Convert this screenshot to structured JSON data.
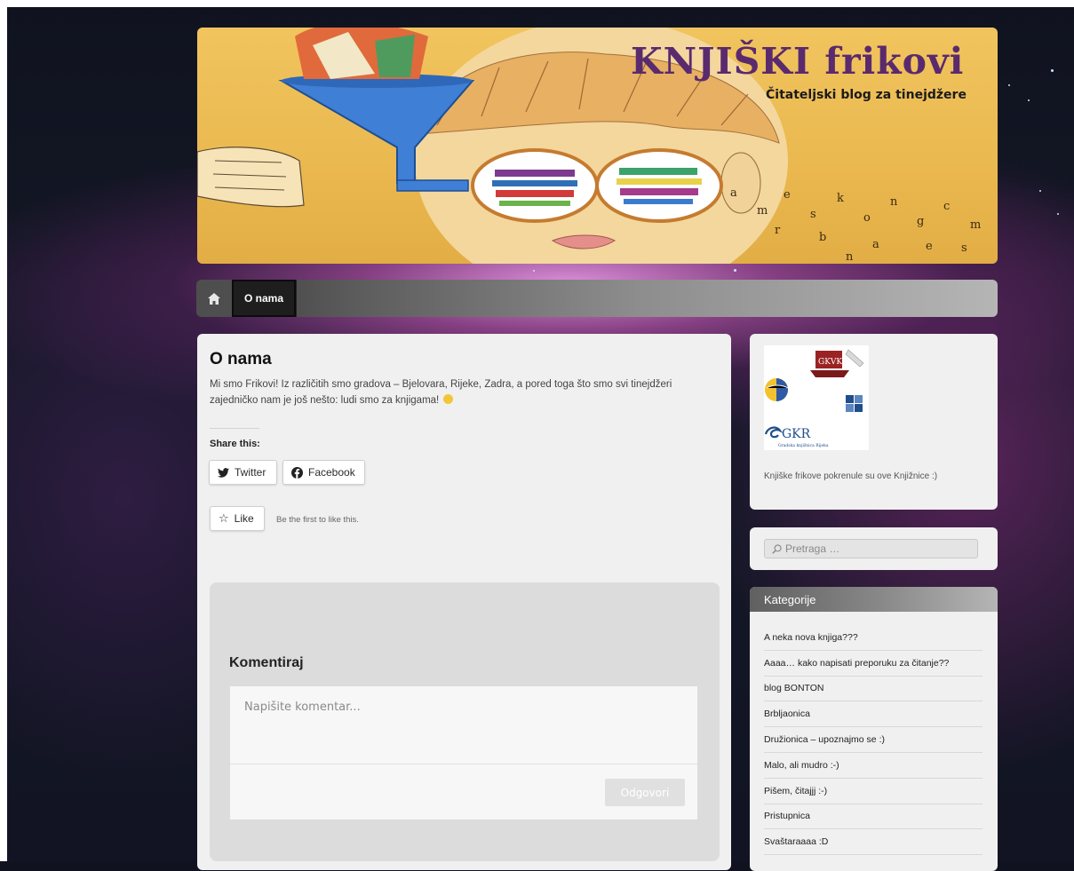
{
  "header": {
    "title": "KNJIŠKI frikovi",
    "tagline": "Čitateljski blog za tinejdžere"
  },
  "nav": {
    "home_icon": "home-icon",
    "items": [
      {
        "label": "O nama",
        "active": true
      }
    ]
  },
  "post": {
    "title": "O nama",
    "text": "Mi smo Frikovi! Iz različitih smo gradova – Bjelovara, Rijeke, Zadra, a pored toga što smo svi tinejdžeri zajedničko nam je još nešto: ludi smo za knjigama!",
    "share_label": "Share this:",
    "share_buttons": [
      {
        "label": "Twitter",
        "icon": "twitter-icon"
      },
      {
        "label": "Facebook",
        "icon": "facebook-icon"
      }
    ],
    "like_label": "Like",
    "like_text": "Be the first to like this."
  },
  "comments": {
    "title": "Komentiraj",
    "placeholder": "Napišite komentar...",
    "reply_label": "Odgovori"
  },
  "sidebar": {
    "logos": {
      "labels": [
        "GKVK",
        "GKR",
        "Gradska knjižnica Rijeka"
      ],
      "caption": "Knjiške frikove pokrenule su ove Knjižnice :)"
    },
    "search": {
      "placeholder": "Pretraga …"
    },
    "categories": {
      "title": "Kategorije",
      "items": [
        "A neka nova knjiga???",
        "Aaaa… kako napisati preporuku za čitanje??",
        "blog BONTON",
        "Brbljaonica",
        "Družionica – upoznajmo se :)",
        "Malo, ali mudro :-)",
        "Pišem, čitajjj :-)",
        "Pristupnica",
        "Svaštaraaaa :D"
      ]
    }
  },
  "colors": {
    "title_purple": "#5a2a6e",
    "banner_yellow": "#f1c45e",
    "panel_bg": "#f0f0f0"
  }
}
